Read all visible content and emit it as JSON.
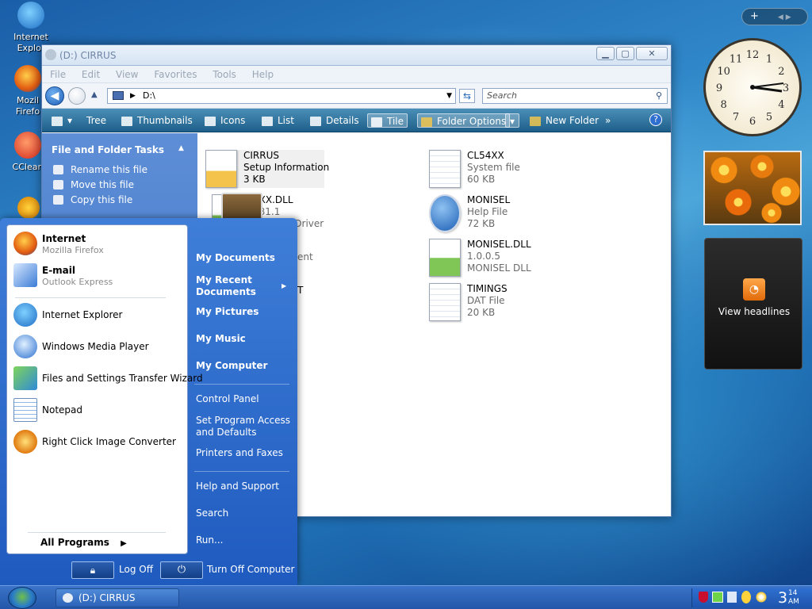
{
  "desktop": {
    "icons": [
      {
        "label": "Internet\nExplorer",
        "icon": "internet-explorer-icon"
      },
      {
        "label": "Mozilla\nFirefox",
        "icon": "firefox-icon"
      },
      {
        "label": "CCleaner",
        "icon": "ccleaner-icon"
      }
    ],
    "icon_labels": [
      "Internet Explor",
      "Mozil Firefo",
      "CClean"
    ]
  },
  "explorer": {
    "title": "(D:) CIRRUS",
    "menu": [
      "File",
      "Edit",
      "View",
      "Favorites",
      "Tools",
      "Help"
    ],
    "address": "D:\\",
    "search_placeholder": "Search",
    "toolbar": {
      "tree": "Tree",
      "thumbnails": "Thumbnails",
      "icons": "Icons",
      "list": "List",
      "details": "Details",
      "tile": "Tile",
      "folder_options": "Folder Options",
      "new_folder": "New Folder",
      "more": "»",
      "help": "?"
    },
    "tasks": {
      "header": "File and Folder Tasks",
      "items": [
        "Rename this file",
        "Move this file",
        "Copy this file"
      ]
    },
    "files": [
      {
        "name": "CIRRUS",
        "type": "Setup Information",
        "size": "3 KB"
      },
      {
        "name": "CL54XX",
        "type": "System file",
        "size": "60 KB"
      },
      {
        "name": "4XX.DLL",
        "type": "381.1",
        "size": "ay Driver"
      },
      {
        "name": "MONISEL",
        "type": "Help File",
        "size": ""
      },
      {
        "name": "ent",
        "type": "",
        "size": ""
      },
      {
        "name": "MONISEL.DLL",
        "type": "1.0.0.5",
        "size": "MONISEL DLL"
      },
      {
        "name": "TIMINGS",
        "type": "DAT File",
        "size": "20 KB"
      }
    ],
    "extra_files": {
      "monisel_size": "72 KB",
      "stray": "T"
    }
  },
  "start_menu": {
    "pinned": [
      {
        "title": "Internet",
        "sub": "Mozilla Firefox"
      },
      {
        "title": "E-mail",
        "sub": "Outlook Express"
      }
    ],
    "recent": [
      "Internet Explorer",
      "Windows Media Player",
      "Files and Settings Transfer Wizard",
      "Notepad",
      "Right Click Image Converter"
    ],
    "all_programs": "All Programs",
    "right": {
      "my_documents": "My Documents",
      "my_recent_1": "My Recent",
      "my_recent_2": "Documents",
      "my_pictures": "My Pictures",
      "my_music": "My Music",
      "my_computer": "My Computer",
      "control_panel": "Control Panel",
      "set_program_1": "Set Program Access",
      "set_program_2": "and Defaults",
      "printers": "Printers and Faxes",
      "help": "Help and Support",
      "search": "Search",
      "run": "Run..."
    },
    "log_off": "Log Off",
    "turn_off": "Turn Off Computer"
  },
  "taskbar": {
    "task": "(D:) CIRRUS",
    "time_hour": "3",
    "time_min": "14",
    "time_ampm": "AM"
  },
  "sidebar": {
    "clock_numbers": [
      "12",
      "1",
      "2",
      "3",
      "4",
      "5",
      "6",
      "7",
      "8",
      "9",
      "10",
      "11"
    ],
    "rss_label": "View headlines"
  },
  "colors": {
    "accent": "#1f5bbf",
    "taskpane": "#4a7fd0",
    "toolbar": "#2d6f98"
  }
}
